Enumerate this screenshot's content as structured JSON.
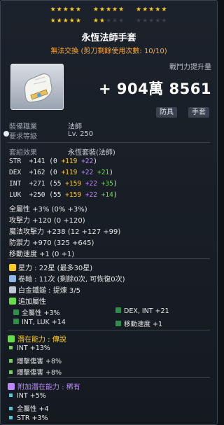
{
  "stars": {
    "row1": "★★★★★ ★★★★★ ★★★★★",
    "row2_gold": "★★★★★ ★★",
    "row2_dim": "★★★",
    "row2_end": "★★★★★"
  },
  "item": {
    "name": "永恆法師手套",
    "trade": "無法交換 (剪刀剩餘使用次數: 10/10)",
    "power_label": "戰鬥力提升量",
    "power_value": "+ 904萬 8561",
    "tag1": "防具",
    "tag2": "手套"
  },
  "requirements": {
    "job_label": "裝備職業",
    "job_value": "法師",
    "level_label": "要求等級",
    "level_value": "Lv. 250"
  },
  "set": {
    "label": "套組效果",
    "value": "永恆套裝(法師)"
  },
  "stats": [
    {
      "name": "STR",
      "total": "+141",
      "base": "0",
      "scroll": "+119",
      "flame": "+22",
      "star": ""
    },
    {
      "name": "DEX",
      "total": "+162",
      "base": "0",
      "scroll": "+119",
      "flame": "+22",
      "star": "+21"
    },
    {
      "name": "INT",
      "total": "+271",
      "base": "55",
      "scroll": "+159",
      "flame": "+22",
      "star": "+35"
    },
    {
      "name": "LUK",
      "total": "+250",
      "base": "55",
      "scroll": "+159",
      "flame": "+22",
      "star": "+14"
    }
  ],
  "extra_stats": {
    "all": "全屬性  +3% (0% +3%)",
    "atk": "攻擊力  +120 (0 +120)",
    "matk": "魔法攻擊力  +238 (12 +127 +99)",
    "def": "防禦力  +970 (325 +645)",
    "spd": "移動速度  +1 (0 +1)"
  },
  "info": {
    "stars": "星力 : 22星 (最多30星)",
    "scroll": "卷軸 : 11次 (剩餘0次, 可恢復0次)",
    "hammer": "白金鐵鎚 : 提煉 3/5",
    "extra": "追加屬性"
  },
  "extra_attr": {
    "a": "全屬性  +3%",
    "b": "DEX, INT  +21",
    "c": "INT, LUK  +14",
    "d": "移動速度  +1"
  },
  "potential": {
    "label": "潛在能力 : 傳說",
    "lines": [
      "INT  +13%",
      "爆擊傷害  +8%",
      "爆擊傷害  +8%"
    ]
  },
  "bonus_potential": {
    "label": "附加潛在能力 : 稀有",
    "lines": [
      "INT  +5%",
      "全屬性  +4",
      "STR  +3%"
    ]
  },
  "colors": {
    "gold": "#ffcc22",
    "green": "#66dd44",
    "purple": "#bb88ff",
    "cyan": "#44ccdd",
    "orange": "#ffaa33"
  }
}
